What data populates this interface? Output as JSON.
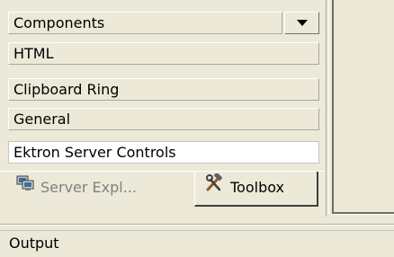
{
  "toolbox": {
    "groups": [
      {
        "label": "Components"
      },
      {
        "label": "HTML"
      },
      {
        "label": "Clipboard Ring"
      },
      {
        "label": "General"
      },
      {
        "label": "Ektron Server Controls"
      }
    ]
  },
  "tabs": {
    "server_explorer": {
      "label": "Server Expl...",
      "icon": "server-explorer-icon"
    },
    "toolbox": {
      "label": "Toolbox",
      "icon": "toolbox-hammer-icon"
    }
  },
  "output": {
    "label": "Output"
  },
  "colors": {
    "background": "#ece9d8",
    "highlight": "#ffffff",
    "shadow": "#aca899",
    "dark_shadow": "#716f64",
    "disabled_text": "#808080"
  }
}
